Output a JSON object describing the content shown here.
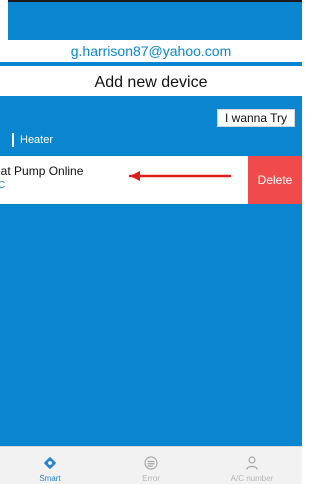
{
  "account": {
    "email": "g.harrison87@yahoo.com"
  },
  "header": {
    "add_device_label": "Add new device"
  },
  "actions": {
    "try_label": "I wanna Try"
  },
  "group": {
    "label": "Heater"
  },
  "device": {
    "title": "eat Pump Online",
    "subtitle": "°C",
    "delete_label": "Delete"
  },
  "bottom_nav": [
    {
      "label": "Smart",
      "icon": "smart-icon"
    },
    {
      "label": "Error",
      "icon": "error-icon"
    },
    {
      "label": "A/C number",
      "icon": "account-icon"
    }
  ],
  "colors": {
    "primary": "#0a86d1",
    "accent": "#2b84d6",
    "danger": "#f04a4a",
    "arrow": "#e11d1d"
  }
}
